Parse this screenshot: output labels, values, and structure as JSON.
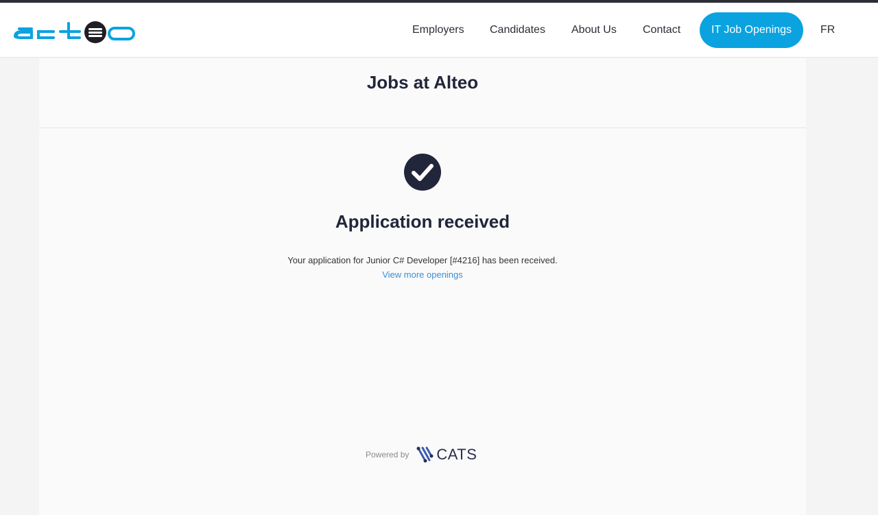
{
  "brand": {
    "logo_text": "alteo",
    "colors": {
      "primary": "#0aa3e0",
      "dark": "#22263a",
      "link": "#3a8fd6"
    }
  },
  "nav": {
    "items": [
      {
        "label": "Employers"
      },
      {
        "label": "Candidates"
      },
      {
        "label": "About Us"
      },
      {
        "label": "Contact"
      }
    ],
    "cta_label": "IT Job Openings",
    "language": "FR"
  },
  "main": {
    "page_title": "Jobs at Alteo",
    "status_icon": "check-circle-icon",
    "success_title": "Application received",
    "message": "Your application for Junior C# Developer [#4216] has been received.",
    "more_link": "View more openings"
  },
  "footer": {
    "powered_by": "Powered by",
    "vendor": "CATS",
    "vendor_icon": "cats-logo-icon"
  }
}
